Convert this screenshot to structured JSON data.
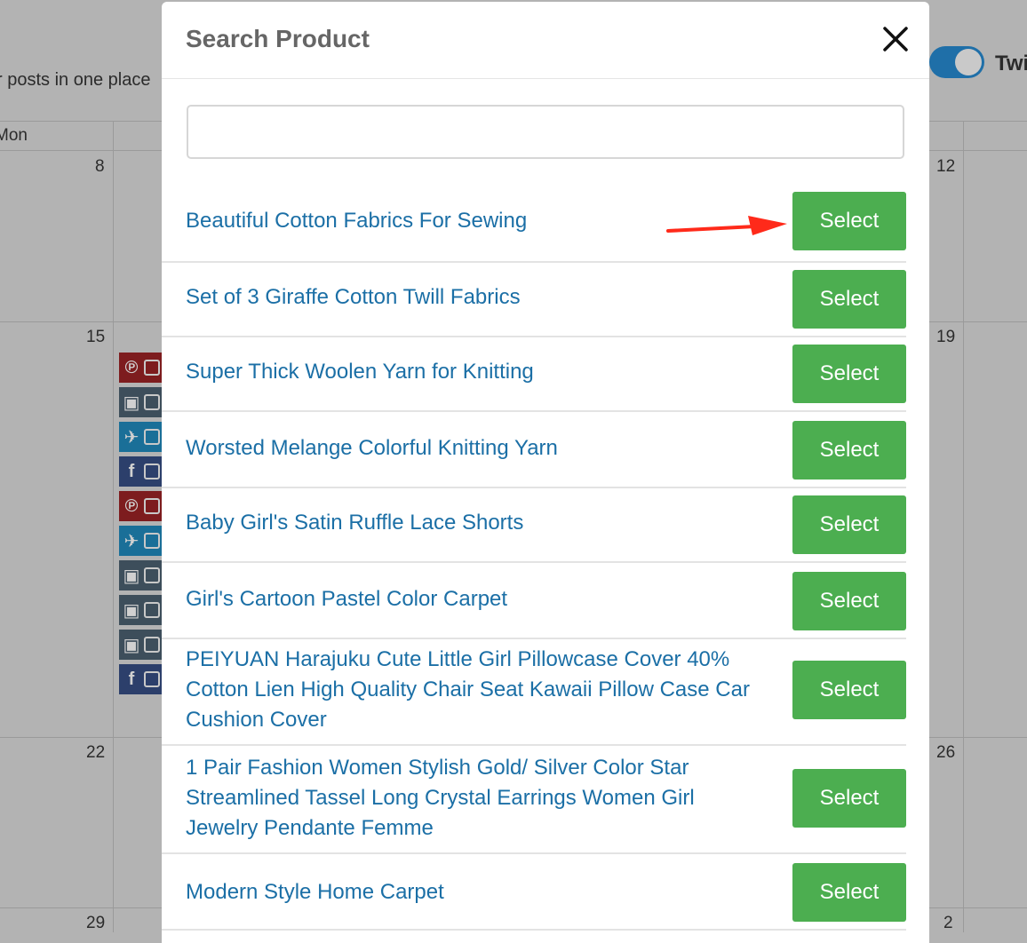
{
  "background": {
    "subtitle_fragment": "r posts in one place",
    "day_header": "Mon",
    "toggle_label": "Twi",
    "dates": [
      "8",
      "12",
      "15",
      "19",
      "22",
      "26",
      "29",
      "2"
    ],
    "social_icons": [
      "pinterest-icon",
      "instagram-icon",
      "twitter-icon",
      "facebook-icon",
      "pinterest-icon",
      "twitter-icon",
      "instagram-icon",
      "instagram-icon",
      "instagram-icon",
      "facebook-icon"
    ]
  },
  "modal": {
    "title": "Search Product",
    "close_icon": "close-icon",
    "search": {
      "value": "",
      "placeholder": ""
    },
    "products": [
      {
        "name": "Beautiful Cotton Fabrics For Sewing",
        "button": "Select"
      },
      {
        "name": "Set of 3 Giraffe Cotton Twill Fabrics",
        "button": "Select"
      },
      {
        "name": "Super Thick Woolen Yarn for Knitting",
        "button": "Select"
      },
      {
        "name": "Worsted Melange Colorful Knitting Yarn",
        "button": "Select"
      },
      {
        "name": "Baby Girl's Satin Ruffle Lace Shorts",
        "button": "Select"
      },
      {
        "name": "Girl's Cartoon Pastel Color Carpet",
        "button": "Select"
      },
      {
        "name": "PEIYUAN Harajuku Cute Little Girl Pillowcase Cover 40% Cotton Lien High Quality Chair Seat Kawaii Pillow Case Car Cushion Cover",
        "button": "Select"
      },
      {
        "name": "1 Pair Fashion Women Stylish Gold/ Silver Color Star Streamlined Tassel Long Crystal Earrings Women Girl Jewelry Pendante Femme",
        "button": "Select"
      },
      {
        "name": "Modern Style Home Carpet",
        "button": "Select"
      }
    ]
  },
  "colors": {
    "select_button": "#4cae50",
    "product_link": "#1b6fa6",
    "annotation_arrow": "#ff2a1a"
  }
}
